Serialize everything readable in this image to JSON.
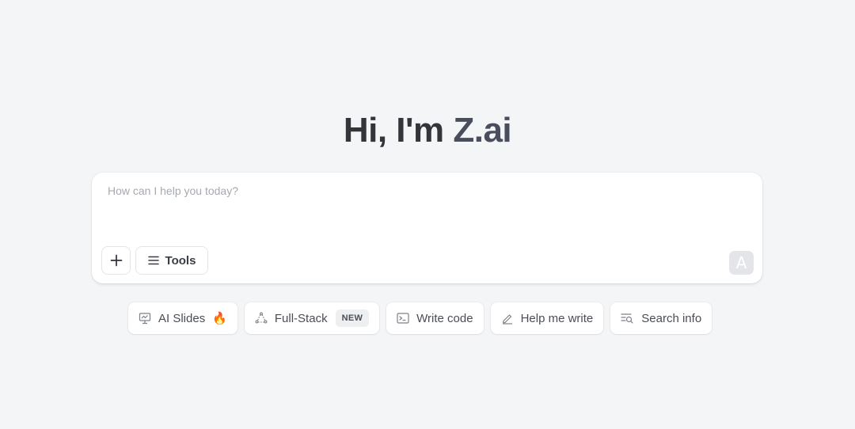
{
  "greeting": {
    "prefix": "Hi, I'm ",
    "brand": "Z.ai"
  },
  "composer": {
    "placeholder": "How can I help you today?",
    "tools_label": "Tools",
    "send_glyph": "A"
  },
  "chips": [
    {
      "label": "AI Slides",
      "icon": "slides-icon",
      "extra": "🔥"
    },
    {
      "label": "Full-Stack",
      "icon": "fullstack-icon",
      "badge": "NEW"
    },
    {
      "label": "Write code",
      "icon": "terminal-icon"
    },
    {
      "label": "Help me write",
      "icon": "pen-icon"
    },
    {
      "label": "Search info",
      "icon": "search-list-icon"
    }
  ],
  "colors": {
    "background": "#f4f5f7",
    "card": "#ffffff",
    "send_disabled": "#e4e5e8",
    "flame": "#f06a21"
  }
}
